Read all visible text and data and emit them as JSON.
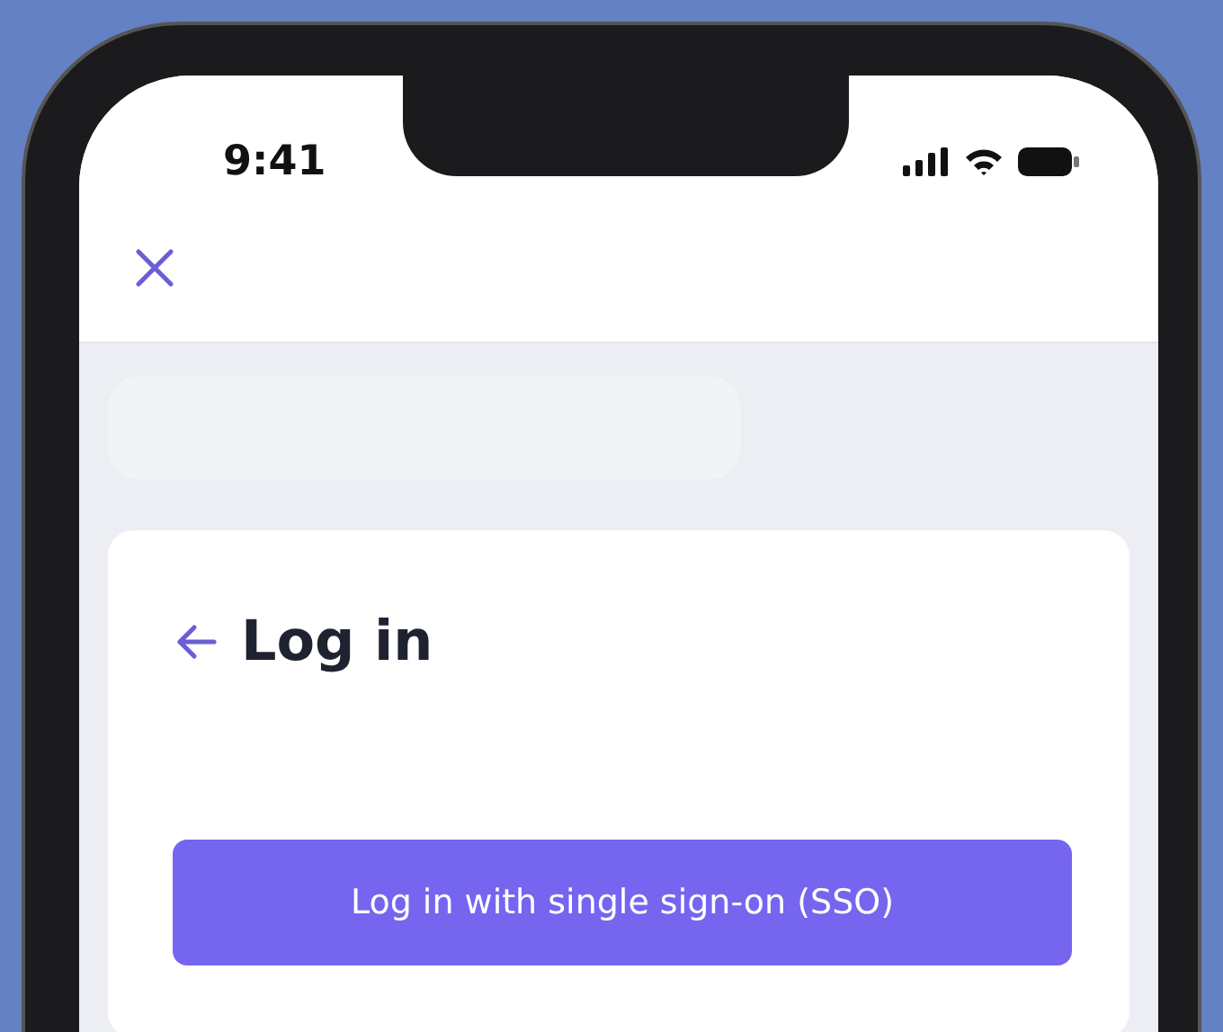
{
  "status_bar": {
    "time": "9:41"
  },
  "login": {
    "title": "Log in",
    "sso_button": "Log in with single sign-on (SSO)"
  }
}
